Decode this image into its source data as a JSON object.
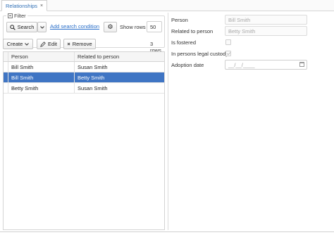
{
  "tab": {
    "title": "Relationships",
    "close": "×"
  },
  "filter": {
    "legend": "Filter",
    "search_label": "Search",
    "add_condition": "Add search condition",
    "show_rows_label": "Show rows",
    "show_rows_value": "50"
  },
  "toolbar": {
    "create_label": "Create",
    "edit_label": "Edit",
    "remove_label": "Remove",
    "rows_count": "3 rows"
  },
  "table": {
    "columns": [
      "Person",
      "Related to person"
    ],
    "rows": [
      [
        "Bill Smith",
        "Susan Smith"
      ],
      [
        "Bill Smith",
        "Betty Smith"
      ],
      [
        "Betty Smith",
        "Susan Smith"
      ]
    ],
    "selected_row": 1
  },
  "form": {
    "person_label": "Person",
    "person_value": "Bill Smith",
    "related_label": "Related to person",
    "related_value": "Betty Smith",
    "fostered_label": "Is fostered",
    "fostered_checked": false,
    "custody_label": "In persons legal custody",
    "custody_checked": true,
    "adoption_label": "Adoption date",
    "adoption_placeholder": "__/__/____"
  },
  "colors": {
    "selection": "#3f75c4",
    "link": "#2a6fc9"
  }
}
